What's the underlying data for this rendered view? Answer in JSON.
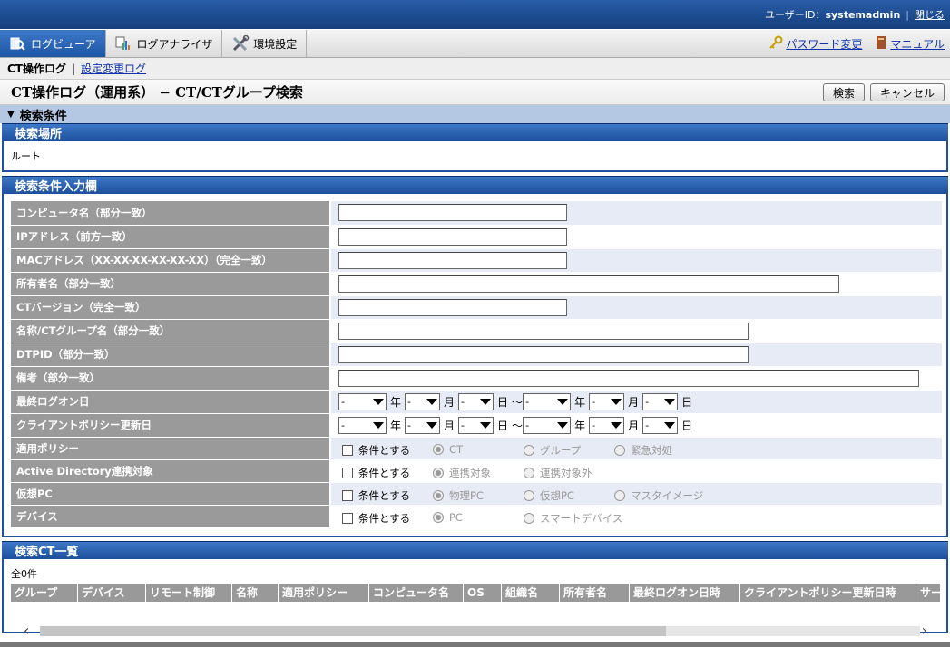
{
  "top": {
    "user_label": "ユーザーID：",
    "user_id": "systemadmin",
    "close": "閉じる"
  },
  "nav": {
    "tabs": [
      {
        "label": "ログビューア"
      },
      {
        "label": "ログアナライザ"
      },
      {
        "label": "環境設定"
      }
    ],
    "password": "パスワード変更",
    "manual": "マニュアル"
  },
  "breadcrumb": {
    "current": "CT操作ログ",
    "separator": "|",
    "link": "設定変更ログ"
  },
  "title": "CT操作ログ（運用系） − CT/CTグループ検索",
  "buttons": {
    "search": "検索",
    "cancel": "キャンセル"
  },
  "condition_header": "検索条件",
  "location": {
    "header": "検索場所",
    "value": "ルート"
  },
  "form": {
    "header": "検索条件入力欄",
    "fields": [
      {
        "label": "コンピュータ名（部分一致）"
      },
      {
        "label": "IPアドレス（前方一致）"
      },
      {
        "label": "MACアドレス（XX-XX-XX-XX-XX-XX）（完全一致）"
      },
      {
        "label": "所有者名（部分一致）"
      },
      {
        "label": "CTバージョン（完全一致）"
      },
      {
        "label": "名称/CTグループ名（部分一致）"
      },
      {
        "label": "DTPID（部分一致）"
      },
      {
        "label": "備考（部分一致）"
      }
    ],
    "date_rows": [
      {
        "label": "最終ログオン日"
      },
      {
        "label": "クライアントポリシー更新日"
      }
    ],
    "date_units": {
      "year": "年",
      "month": "月",
      "day": "日",
      "tilde": "〜",
      "empty": "-"
    },
    "option_rows": [
      {
        "label": "適用ポリシー",
        "check": "条件とする",
        "options": [
          "CT",
          "グループ",
          "緊急対処"
        ]
      },
      {
        "label": "Active Directory連携対象",
        "check": "条件とする",
        "options": [
          "連携対象",
          "連携対象外"
        ]
      },
      {
        "label": "仮想PC",
        "check": "条件とする",
        "options": [
          "物理PC",
          "仮想PC",
          "マスタイメージ"
        ]
      },
      {
        "label": "デバイス",
        "check": "条件とする",
        "options": [
          "PC",
          "スマートデバイス"
        ]
      }
    ]
  },
  "list": {
    "header": "検索CT一覧",
    "count": "全0件",
    "columns": [
      "グループ",
      "デバイス",
      "リモート制御",
      "名称",
      "適用ポリシー",
      "コンピュータ名",
      "OS",
      "組織名",
      "所有者名",
      "最終ログオン日時",
      "クライアントポリシー更新日時",
      "サー"
    ]
  },
  "icons": {
    "tab0": "log-viewer-icon",
    "tab1": "log-analyzer-icon",
    "tab2": "tools-icon",
    "password": "key-icon",
    "manual": "book-icon"
  }
}
